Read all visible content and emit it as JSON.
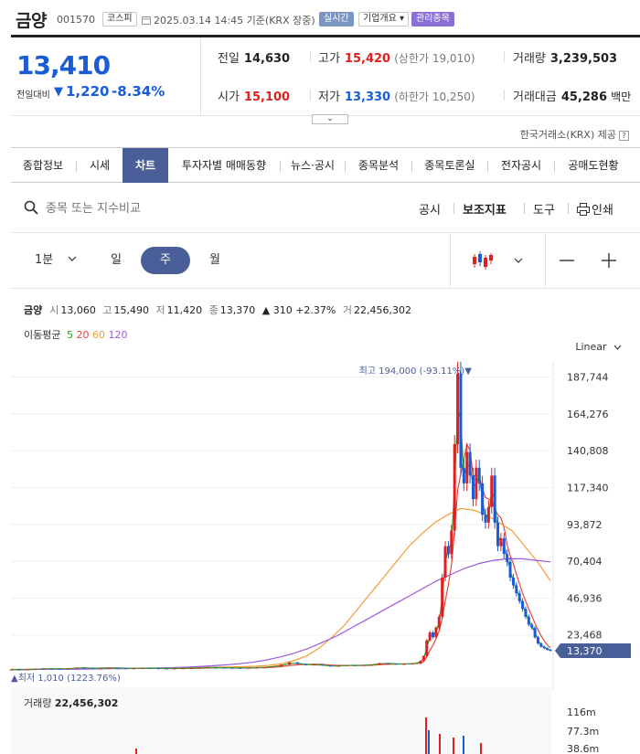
{
  "header": {
    "name": "금양",
    "code": "001570",
    "market": "코스피",
    "datetime": "2025.03.14 14:45 기준(KRX 장중)",
    "live_badge": "실시간",
    "company_badge": "기업개요 ▾",
    "warn_badge": "관리종목"
  },
  "price": {
    "current": "13,410",
    "change_label": "전일대비",
    "change_arrow": "▼",
    "change": "1,220",
    "change_pct": "-8.34%"
  },
  "quotes": {
    "prev_close_label": "전일",
    "prev_close": "14,630",
    "high_label": "고가",
    "high": "15,420",
    "upper_limit": "(상한가 19,010)",
    "volume_label": "거래량",
    "volume": "3,239,503",
    "open_label": "시가",
    "open": "15,100",
    "low_label": "저가",
    "low": "13,330",
    "lower_limit": "(하한가 10,250)",
    "amount_label": "거래대금",
    "amount": "45,286",
    "amount_unit": "백만"
  },
  "provider": "한국거래소(KRX) 제공",
  "tabs": [
    "종합정보",
    "시세",
    "차트",
    "투자자별 매매동향",
    "뉴스·공시",
    "종목분석",
    "종목토론실",
    "전자공시",
    "공매도현황"
  ],
  "toolbar": {
    "search_placeholder": "종목 또는 지수비교",
    "disclosure": "공시",
    "indicator": "보조지표",
    "tools": "도구",
    "print": "인쇄"
  },
  "period": {
    "minute": "1분",
    "day": "일",
    "week": "주",
    "month": "월"
  },
  "summary": {
    "name": "금양",
    "open_k": "시",
    "open": "13,060",
    "high_k": "고",
    "high": "15,490",
    "low_k": "저",
    "low": "11,420",
    "close_k": "종",
    "close": "13,370",
    "change": "▲ 310 +2.37%",
    "vol_k": "거",
    "volume": "22,456,302"
  },
  "ma": {
    "label": "이동평균",
    "ma5": "5",
    "ma20": "20",
    "ma60": "60",
    "ma120": "120"
  },
  "scale_mode": "Linear",
  "volume_panel": {
    "label": "거래량",
    "value": "22,456,302"
  },
  "colors": {
    "up": "#e02020",
    "down": "#1a5bd6",
    "accent": "#4a5f9a",
    "ma5": "#2e9e2e",
    "ma20": "#e8453c",
    "ma60": "#f39c34",
    "ma120": "#9b59e0"
  },
  "chart_data": {
    "type": "line",
    "title": "",
    "scale": "Linear",
    "xlabel": "",
    "ylabel": "",
    "ylim": [
      0,
      198000
    ],
    "y_ticks": [
      187744,
      164276,
      140808,
      117340,
      93872,
      70404,
      46936,
      23468
    ],
    "y_tick_labels": [
      "187,744",
      "164,276",
      "140,808",
      "117,340",
      "93,872",
      "70,404",
      "46,936",
      "23,468"
    ],
    "current_price_label": "13,370",
    "current_price": 13370,
    "max_annotation": "최고 194,000 (-93.11%)▼",
    "max_value": 194000,
    "min_annotation": "▲최저 1,010 (1223.76%)",
    "min_value": 1010,
    "series": [
      {
        "name": "주가",
        "values": [
          1400,
          1300,
          1500,
          1800,
          2000,
          1900,
          1700,
          2100,
          2600,
          2400,
          2200,
          2300,
          2500,
          2300,
          2100,
          2200,
          2300,
          2200,
          2100,
          2000,
          2100,
          2200,
          2300,
          2500,
          2700,
          2600,
          2500,
          2400,
          2300,
          2500,
          2700,
          3000,
          3500,
          4500,
          6000,
          5000,
          4200,
          4600,
          4000,
          3500,
          3800,
          4200,
          4000,
          4300,
          4500,
          5500,
          5200,
          4800,
          5000,
          5200,
          7000,
          10000,
          20000,
          25000,
          22000,
          28000,
          35000,
          60000,
          80000,
          75000,
          90000,
          145000,
          190000,
          130000,
          120000,
          140000,
          125000,
          110000,
          130000,
          120000,
          100000,
          95000,
          105000,
          125000,
          95000,
          80000,
          85000,
          75000,
          70000,
          60000,
          55000,
          50000,
          45000,
          40000,
          35000,
          30000,
          28000,
          22000,
          18000,
          16000,
          15000,
          14000,
          13370
        ]
      },
      {
        "name": "5",
        "values": []
      },
      {
        "name": "20",
        "values": []
      },
      {
        "name": "60",
        "values": [
          1500,
          1550,
          1600,
          1650,
          1700,
          1800,
          1900,
          2000,
          2100,
          2200,
          2300,
          2400,
          2500,
          2600,
          2700,
          2800,
          2900,
          3000,
          3200,
          3500,
          4000,
          5000,
          7000,
          10000,
          15000,
          22000,
          30000,
          40000,
          50000,
          60000,
          70000,
          80000,
          88000,
          95000,
          100000,
          104000,
          103000,
          100000,
          95000,
          90000,
          80000,
          70000,
          58000
        ]
      },
      {
        "name": "120",
        "values": [
          1400,
          1450,
          1500,
          1550,
          1600,
          1700,
          1800,
          1900,
          2000,
          2100,
          2300,
          2500,
          2800,
          3200,
          3700,
          4300,
          5000,
          6000,
          7500,
          9500,
          12000,
          15000,
          19000,
          23000,
          28000,
          33000,
          38000,
          43000,
          48000,
          53000,
          58000,
          62000,
          66000,
          69000,
          71000,
          72000,
          72000,
          71000,
          70000
        ]
      }
    ],
    "volume": {
      "ticks": [
        "116m",
        "77.3m",
        "38.6m"
      ]
    }
  }
}
